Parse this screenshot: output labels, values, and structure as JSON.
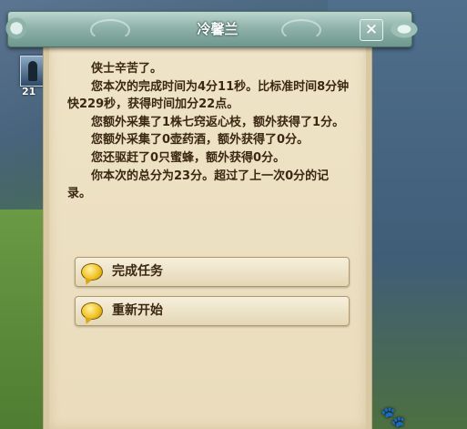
{
  "hud": {
    "avatar_level": "21",
    "paw_icon": "paw-icon"
  },
  "dialog": {
    "title": "冷馨兰",
    "close_label": "✕",
    "message": [
      "侠士辛苦了。",
      "您本次的完成时间为4分11秒。比标准时间8分钟快229秒，获得时间加分22点。",
      "您额外采集了1株七窍返心枝，额外获得了1分。",
      "您额外采集了0壶药酒，额外获得了0分。",
      "您还驱赶了0只蜜蜂，额外获得0分。",
      "你本次的总分为23分。超过了上一次0分的记录。"
    ],
    "options": [
      {
        "label": "完成任务",
        "icon": "speech-bubble-icon"
      },
      {
        "label": "重新开始",
        "icon": "speech-bubble-icon"
      }
    ]
  },
  "colors": {
    "title_bar": "#8fb3aa",
    "panel": "#efe4c8",
    "text": "#3b2712"
  }
}
